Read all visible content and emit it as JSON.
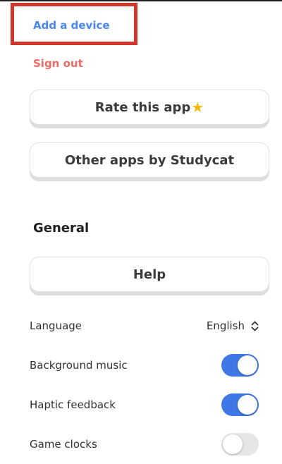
{
  "account": {
    "add_device_label": "Add a device",
    "sign_out_label": "Sign out"
  },
  "buttons": {
    "rate_label": "Rate this app",
    "rate_icon": "star-icon",
    "other_apps_label": "Other apps by Studycat",
    "help_label": "Help"
  },
  "general": {
    "heading": "General",
    "language_label": "Language",
    "language_value": "English",
    "background_music_label": "Background music",
    "background_music_on": true,
    "haptic_feedback_label": "Haptic feedback",
    "haptic_feedback_on": true,
    "game_clocks_label": "Game clocks",
    "game_clocks_on": false
  },
  "colors": {
    "link_blue": "#4a86f0",
    "link_red": "#ee6b63",
    "highlight_box": "#d0372c",
    "toggle_on": "#3f78e6",
    "toggle_off": "#e6e6e6",
    "star": "#f2b90a"
  }
}
